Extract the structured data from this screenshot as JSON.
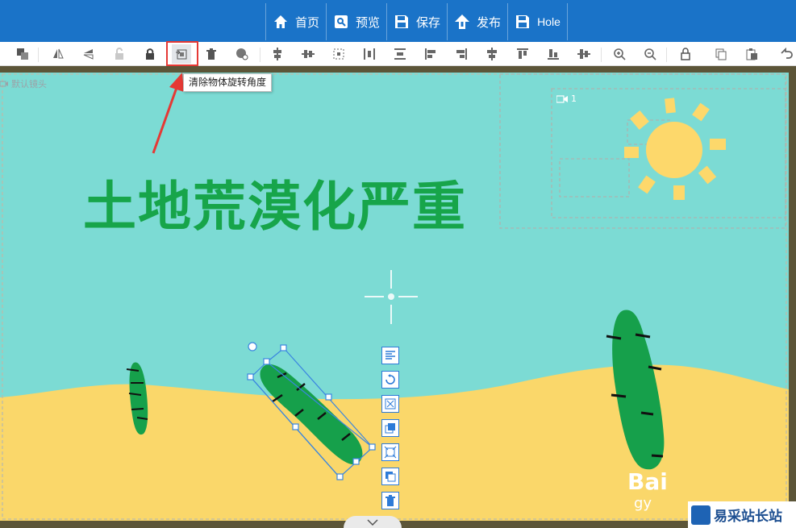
{
  "topmenu": {
    "items": [
      {
        "icon": "home-icon",
        "label": "首页"
      },
      {
        "icon": "preview-icon",
        "label": "预览"
      },
      {
        "icon": "save-icon",
        "label": "保存"
      },
      {
        "icon": "publish-icon",
        "label": "发布"
      },
      {
        "icon": "hole-save-icon",
        "label": "Hole"
      }
    ]
  },
  "toolbar": {
    "tooltip": "清除物体旋转角度",
    "highlighted_tool": "clear-rotation-icon"
  },
  "stage": {
    "default_camera_label": "默认镜头",
    "camera_1_label": "1",
    "headline": "土地荒漠化严重",
    "colors": {
      "sky": "#7cdbd4",
      "sand": "#fad76a",
      "cactus": "#16a04b",
      "sun": "#fdd86b",
      "headline": "#17a54a"
    }
  },
  "object_tools": [
    "align-icon",
    "rotate-reset-icon",
    "fit-icon",
    "layer-up-icon",
    "resize-icon",
    "layer-down-icon",
    "delete-icon"
  ],
  "watermark": {
    "logo_text": "易采站长站",
    "partial_text": "Bai",
    "partial_sub": "gy"
  }
}
